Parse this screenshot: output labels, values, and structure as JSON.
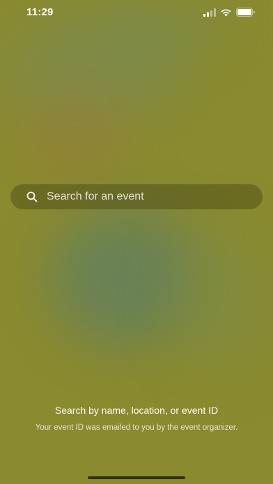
{
  "status_bar": {
    "time": "11:29",
    "icons": [
      "signal-icon",
      "wifi-icon",
      "battery-icon"
    ]
  },
  "search": {
    "placeholder": "Search for an event",
    "value": "",
    "icon": "search-icon"
  },
  "help": {
    "title": "Search by name, location, or event ID",
    "subtitle": "Your event ID was emailed to you by the event organizer."
  },
  "colors": {
    "background": "#8a8a2e",
    "text": "#ffffff",
    "search_bar_fill": "#46461480"
  }
}
